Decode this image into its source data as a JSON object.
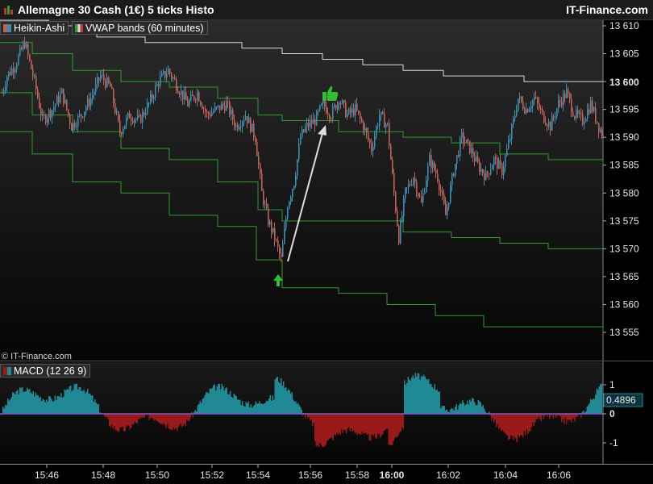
{
  "header": {
    "title": "Allemagne 30 Cash (1€) 5 ticks Histo",
    "brand": "IT-Finance.com"
  },
  "legend": {
    "heikin": "Heikin-Ashi",
    "vwap": "VWAP bands (60 minutes)",
    "macd": "MACD (12 26 9)",
    "copyright": "© IT-Finance.com"
  },
  "colors": {
    "up": "#3a8fb0",
    "down": "#c0625a",
    "vwap_center": "#d9d9d9",
    "vwap_band": "#2e9e2e",
    "macd_pos": "#1f8a94",
    "macd_neg": "#9a1a1a",
    "signal_up": "#2fbf2f"
  },
  "chart_data": [
    {
      "type": "candlestick",
      "title": "Allemagne 30 Cash (1€) 5 ticks Histo",
      "y_ticks": [
        "13 610",
        "13 605",
        "13 600",
        "13 595",
        "13 590",
        "13 585",
        "13 580",
        "13 575",
        "13 570",
        "13 565",
        "13 560",
        "13 555"
      ],
      "y_range": [
        13552,
        13613
      ],
      "last_price_label": "13 600",
      "x_ticks": [
        "15:46",
        "15:48",
        "15:50",
        "15:52",
        "15:54",
        "15:56",
        "15:58",
        "16:00",
        "16:02",
        "16:04",
        "16:06"
      ],
      "price_path": [
        [
          0,
          13597
        ],
        [
          8,
          13601
        ],
        [
          18,
          13603
        ],
        [
          30,
          13607
        ],
        [
          42,
          13600
        ],
        [
          52,
          13593
        ],
        [
          64,
          13595
        ],
        [
          76,
          13598
        ],
        [
          88,
          13592
        ],
        [
          100,
          13594
        ],
        [
          112,
          13597
        ],
        [
          124,
          13601
        ],
        [
          136,
          13599
        ],
        [
          148,
          13591
        ],
        [
          160,
          13594
        ],
        [
          172,
          13593
        ],
        [
          184,
          13596
        ],
        [
          196,
          13600
        ],
        [
          208,
          13602
        ],
        [
          220,
          13599
        ],
        [
          232,
          13596
        ],
        [
          244,
          13598
        ],
        [
          256,
          13594
        ],
        [
          268,
          13595
        ],
        [
          280,
          13596
        ],
        [
          292,
          13592
        ],
        [
          304,
          13594
        ],
        [
          316,
          13590
        ],
        [
          324,
          13580
        ],
        [
          332,
          13575
        ],
        [
          340,
          13572
        ],
        [
          348,
          13568
        ],
        [
          356,
          13578
        ],
        [
          364,
          13582
        ],
        [
          372,
          13590
        ],
        [
          380,
          13592
        ],
        [
          390,
          13593
        ],
        [
          400,
          13596
        ],
        [
          410,
          13594
        ],
        [
          420,
          13597
        ],
        [
          430,
          13594
        ],
        [
          440,
          13595
        ],
        [
          450,
          13592
        ],
        [
          460,
          13588
        ],
        [
          470,
          13594
        ],
        [
          480,
          13592
        ],
        [
          488,
          13580
        ],
        [
          494,
          13572
        ],
        [
          502,
          13580
        ],
        [
          512,
          13583
        ],
        [
          522,
          13578
        ],
        [
          532,
          13586
        ],
        [
          542,
          13583
        ],
        [
          552,
          13576
        ],
        [
          562,
          13584
        ],
        [
          572,
          13590
        ],
        [
          582,
          13588
        ],
        [
          592,
          13585
        ],
        [
          602,
          13583
        ],
        [
          612,
          13586
        ],
        [
          622,
          13584
        ],
        [
          632,
          13590
        ],
        [
          642,
          13597
        ],
        [
          652,
          13595
        ],
        [
          662,
          13597
        ],
        [
          672,
          13594
        ],
        [
          682,
          13592
        ],
        [
          692,
          13596
        ],
        [
          702,
          13598
        ],
        [
          712,
          13594
        ],
        [
          722,
          13593
        ],
        [
          732,
          13596
        ],
        [
          742,
          13592
        ],
        [
          748,
          13590
        ]
      ],
      "vwap_center": [
        [
          0,
          13611
        ],
        [
          60,
          13610
        ],
        [
          120,
          13608
        ],
        [
          180,
          13607
        ],
        [
          240,
          13607
        ],
        [
          300,
          13606
        ],
        [
          320,
          13606
        ],
        [
          350,
          13605
        ],
        [
          400,
          13604
        ],
        [
          450,
          13603
        ],
        [
          500,
          13602
        ],
        [
          550,
          13601
        ],
        [
          600,
          13601
        ],
        [
          650,
          13600
        ],
        [
          700,
          13600
        ],
        [
          748,
          13600
        ]
      ],
      "vwap_upper": [
        [
          0,
          13607
        ],
        [
          40,
          13605
        ],
        [
          90,
          13602
        ],
        [
          150,
          13600
        ],
        [
          210,
          13599
        ],
        [
          270,
          13597
        ],
        [
          320,
          13594
        ],
        [
          350,
          13593
        ],
        [
          420,
          13591
        ],
        [
          500,
          13590
        ],
        [
          560,
          13589
        ],
        [
          620,
          13587
        ],
        [
          680,
          13586
        ],
        [
          748,
          13585
        ]
      ],
      "vwap_lower_1": [
        [
          0,
          13598
        ],
        [
          40,
          13594
        ],
        [
          90,
          13591
        ],
        [
          150,
          13588
        ],
        [
          210,
          13586
        ],
        [
          270,
          13582
        ],
        [
          320,
          13577
        ],
        [
          350,
          13575
        ],
        [
          420,
          13575
        ],
        [
          500,
          13573
        ],
        [
          560,
          13572
        ],
        [
          620,
          13571
        ],
        [
          680,
          13570
        ],
        [
          748,
          13570
        ]
      ],
      "vwap_lower_2": [
        [
          0,
          13591
        ],
        [
          40,
          13587
        ],
        [
          90,
          13582
        ],
        [
          150,
          13580
        ],
        [
          210,
          13576
        ],
        [
          270,
          13574
        ],
        [
          318,
          13568
        ],
        [
          350,
          13563
        ],
        [
          420,
          13562
        ],
        [
          480,
          13560
        ],
        [
          540,
          13558
        ],
        [
          600,
          13556
        ],
        [
          680,
          13556
        ],
        [
          748,
          13555
        ]
      ],
      "annotations": [
        "buy arrow near 13 567 at ~15:54",
        "thumbs-up near 13 597 at ~15:57"
      ]
    },
    {
      "type": "bar",
      "title": "MACD (12 26 9)",
      "y_ticks": [
        "1",
        "0",
        "-1"
      ],
      "value_label": "0.4896",
      "y_range": [
        -1.8,
        1.7
      ]
    }
  ]
}
